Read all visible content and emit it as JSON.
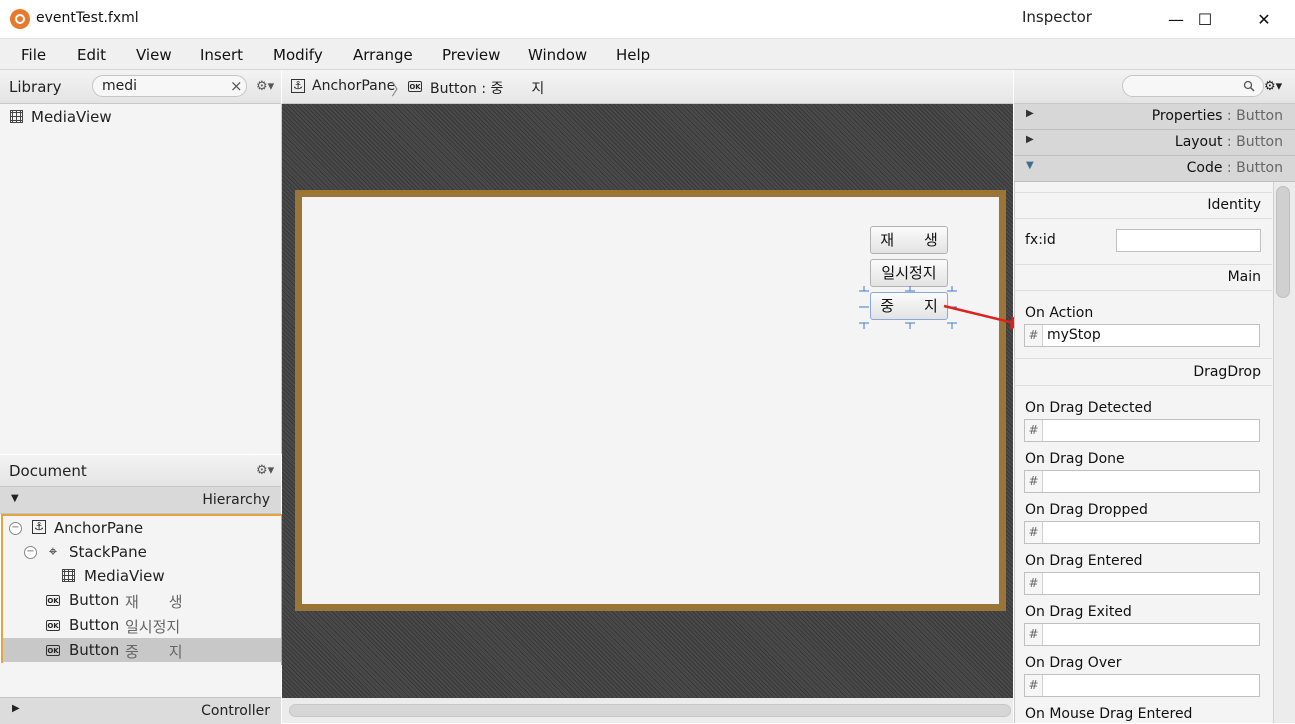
{
  "window": {
    "title": "eventTest.fxml",
    "minimize_glyph": "—",
    "maximize_glyph": "☐",
    "close_glyph": "✕"
  },
  "menu": [
    "File",
    "Edit",
    "View",
    "Insert",
    "Modify",
    "Arrange",
    "Preview",
    "Window",
    "Help"
  ],
  "library": {
    "title": "Library",
    "search_value": "medi",
    "clear_glyph": "×",
    "gear_glyph": "⚙▾",
    "items": [
      {
        "label": "MediaView",
        "icon": "grid-icon"
      }
    ]
  },
  "document": {
    "title": "Document",
    "gear_glyph": "⚙▾",
    "hierarchy_label": "Hierarchy",
    "controller_label": "Controller",
    "tree": [
      {
        "label": "AnchorPane",
        "icon": "anchor-icon",
        "depth": 0,
        "collapsible": true,
        "selected": false
      },
      {
        "label": "StackPane",
        "icon": "stack-icon",
        "depth": 1,
        "collapsible": true,
        "selected": false
      },
      {
        "label": "MediaView",
        "icon": "grid-icon",
        "depth": 2,
        "collapsible": false,
        "selected": false
      },
      {
        "label": "Button",
        "sub": "재　　생",
        "icon": "ok-icon",
        "depth": 1,
        "collapsible": false,
        "selected": false
      },
      {
        "label": "Button",
        "sub": "일시정지",
        "icon": "ok-icon",
        "depth": 1,
        "collapsible": false,
        "selected": false
      },
      {
        "label": "Button",
        "sub": "중　　지",
        "icon": "ok-icon",
        "depth": 1,
        "collapsible": false,
        "selected": true
      }
    ]
  },
  "breadcrumb": {
    "items": [
      {
        "label": "AnchorPane",
        "icon": "anchor-icon"
      },
      {
        "label": "Button : 중　　지",
        "icon": "ok-icon"
      }
    ],
    "separator": "〉"
  },
  "canvas": {
    "buttons": [
      "재　　생",
      "일시정지",
      "중　　지"
    ]
  },
  "inspector": {
    "title": "Inspector",
    "gear_glyph": "⚙▾",
    "search_icon": "magnifier-icon",
    "sections": [
      {
        "label": "Properties",
        "sub": " : Button",
        "expanded": false
      },
      {
        "label": "Layout",
        "sub": " : Button",
        "expanded": false
      },
      {
        "label": "Code",
        "sub": " : Button",
        "expanded": true
      }
    ],
    "identity_label": "Identity",
    "fxid_label": "fx:id",
    "fxid_value": "",
    "main_label": "Main",
    "on_action_label": "On Action",
    "on_action_value": "myStop",
    "dragdrop_label": "DragDrop",
    "hash_glyph": "#",
    "dragdrop_fields": [
      {
        "label": "On Drag Detected",
        "value": ""
      },
      {
        "label": "On Drag Done",
        "value": ""
      },
      {
        "label": "On Drag Dropped",
        "value": ""
      },
      {
        "label": "On Drag Entered",
        "value": ""
      },
      {
        "label": "On Drag Exited",
        "value": ""
      },
      {
        "label": "On Drag Over",
        "value": ""
      },
      {
        "label": "On Mouse Drag Entered",
        "value": ""
      }
    ]
  },
  "colors": {
    "stage_border": "#9b7538",
    "selection_outline": "#e3a43b",
    "annotation_arrow": "#e0201c"
  }
}
